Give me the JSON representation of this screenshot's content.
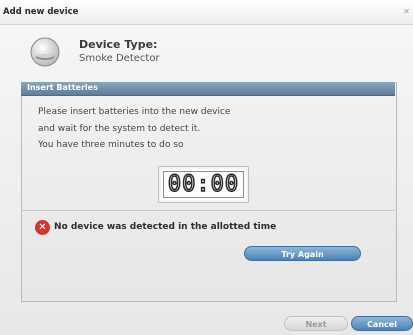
{
  "dialog": {
    "title": "Add new device"
  },
  "device": {
    "type_label": "Device Type:",
    "type_value": "Smoke Detector"
  },
  "panel": {
    "header": "Insert Batteries",
    "instructions": [
      "Please insert batteries into the new device",
      "and wait for the system to detect it.",
      "You have three minutes to do so"
    ],
    "timer": "00:00",
    "error_message": "No device was detected in the allotted time",
    "try_again_label": "Try Again"
  },
  "footer": {
    "next_label": "Next",
    "cancel_label": "Cancel"
  },
  "colors": {
    "accent_blue": "#4f82b2",
    "error_red": "#d6342b"
  },
  "icons": {
    "device": "smoke-detector-icon",
    "error": "error-icon",
    "close": "close-icon"
  }
}
